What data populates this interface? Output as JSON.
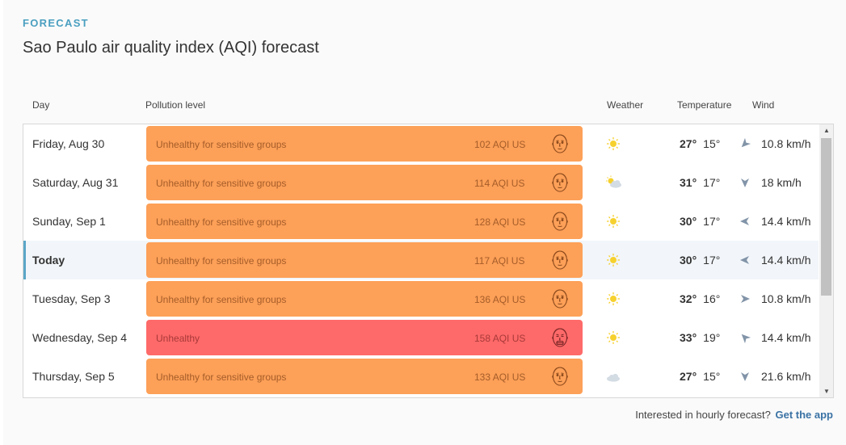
{
  "header": {
    "eyebrow": "FORECAST",
    "title": "Sao Paulo air quality index (AQI) forecast"
  },
  "columns": {
    "day": "Day",
    "pollution": "Pollution level",
    "weather": "Weather",
    "temperature": "Temperature",
    "wind": "Wind"
  },
  "rows": [
    {
      "day": "Friday, Aug 30",
      "level": "Unhealthy for sensitive groups",
      "aqi": "102 AQI US",
      "weather": "sun-icon",
      "hi": "27°",
      "lo": "15°",
      "wind_dir": "southwest",
      "wind": "10.8 km/h",
      "color": "#fda058"
    },
    {
      "day": "Saturday, Aug 31",
      "level": "Unhealthy for sensitive groups",
      "aqi": "114 AQI US",
      "weather": "partly-cloudy-icon",
      "hi": "31°",
      "lo": "17°",
      "wind_dir": "south",
      "wind": "18 km/h",
      "color": "#fda058"
    },
    {
      "day": "Sunday, Sep 1",
      "level": "Unhealthy for sensitive groups",
      "aqi": "128 AQI US",
      "weather": "sun-icon",
      "hi": "30°",
      "lo": "17°",
      "wind_dir": "west",
      "wind": "14.4 km/h",
      "color": "#fda058"
    },
    {
      "day": "Today",
      "level": "Unhealthy for sensitive groups",
      "aqi": "117 AQI US",
      "weather": "sun-icon",
      "hi": "30°",
      "lo": "17°",
      "wind_dir": "west",
      "wind": "14.4 km/h",
      "color": "#fda058"
    },
    {
      "day": "Tuesday, Sep 3",
      "level": "Unhealthy for sensitive groups",
      "aqi": "136 AQI US",
      "weather": "sun-icon",
      "hi": "32°",
      "lo": "16°",
      "wind_dir": "east",
      "wind": "10.8 km/h",
      "color": "#fda058"
    },
    {
      "day": "Wednesday, Sep 4",
      "level": "Unhealthy",
      "aqi": "158 AQI US",
      "weather": "sun-icon",
      "hi": "33°",
      "lo": "19°",
      "wind_dir": "northwest",
      "wind": "14.4 km/h",
      "color": "#fe6a69"
    },
    {
      "day": "Thursday, Sep 5",
      "level": "Unhealthy for sensitive groups",
      "aqi": "133 AQI US",
      "weather": "cloud-icon",
      "hi": "27°",
      "lo": "15°",
      "wind_dir": "south",
      "wind": "21.6 km/h",
      "color": "#fda058"
    }
  ],
  "footer": {
    "prompt": "Interested in hourly forecast?",
    "link": "Get the app"
  }
}
